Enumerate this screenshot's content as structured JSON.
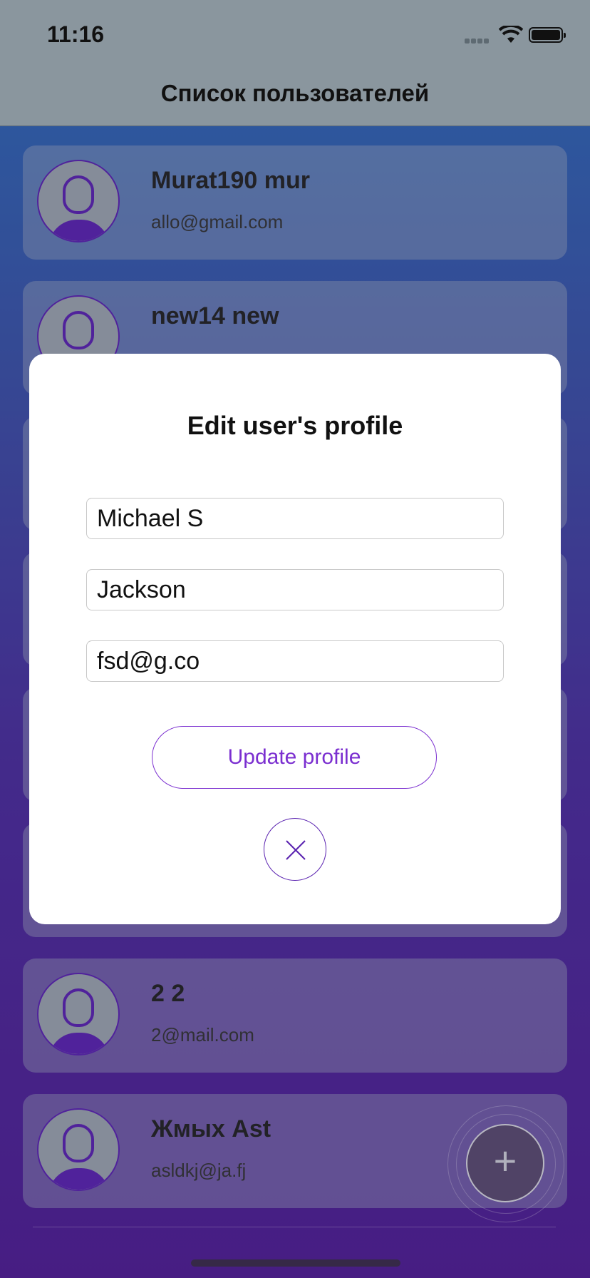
{
  "status_bar": {
    "time": "11:16"
  },
  "nav": {
    "title": "Список пользователей"
  },
  "users": [
    {
      "name": "Murat190 mur",
      "email": "allo@gmail.com"
    },
    {
      "name": "new14 new",
      "email": ""
    },
    {
      "name": "",
      "email": ""
    },
    {
      "name": "",
      "email": ""
    },
    {
      "name": "",
      "email": ""
    },
    {
      "name": "",
      "email": ""
    },
    {
      "name": "2 2",
      "email": "2@mail.com"
    },
    {
      "name": "Жмых Ast",
      "email": "asldkj@ja.fj"
    }
  ],
  "modal": {
    "title": "Edit user's profile",
    "first_name": "Michael S",
    "last_name": "Jackson",
    "email": "fsd@g.co",
    "update_label": "Update profile"
  },
  "fab": {
    "label": "+"
  },
  "colors": {
    "accent": "#7b2fd0",
    "avatar_purple": "#5a22b0"
  },
  "icons": {
    "close": "close-icon",
    "add": "plus-icon",
    "avatar": "user-silhouette-icon"
  }
}
